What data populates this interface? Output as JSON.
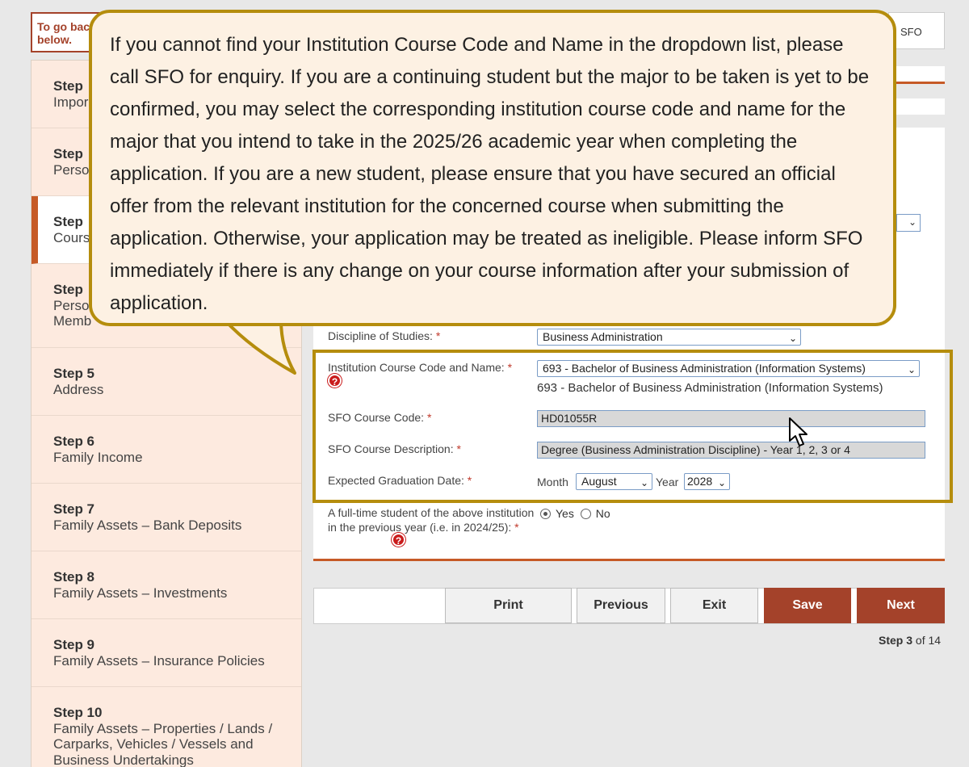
{
  "top": {
    "note": "To go back to ... below.",
    "note_visible_line1": "To go bac",
    "note_visible_line2": "below.",
    "right_label": "SFO"
  },
  "sidebar": {
    "steps": [
      {
        "num": "Step",
        "label": "Impor"
      },
      {
        "num": "Step",
        "label": "Perso"
      },
      {
        "num": "Step",
        "label": "Cours"
      },
      {
        "num": "Step",
        "label": "Perso",
        "label2": "Memb"
      },
      {
        "num": "Step 5",
        "label": "Address"
      },
      {
        "num": "Step 6",
        "label": "Family Income"
      },
      {
        "num": "Step 7",
        "label": "Family Assets – Bank Deposits"
      },
      {
        "num": "Step 8",
        "label": "Family Assets – Investments"
      },
      {
        "num": "Step 9",
        "label": "Family Assets – Insurance Policies"
      },
      {
        "num": "Step 10",
        "label": "Family Assets – Properties / Lands / Carparks, Vehicles / Vessels and Business Undertakings"
      }
    ]
  },
  "callout": {
    "text": "If you cannot find your Institution Course Code and Name in the dropdown list, please call SFO for enquiry.  If you are a continuing student but the major to be taken is yet to be confirmed, you may select the corresponding institution course code and name for the major that you intend to take in the 2025/26 academic year when completing the application. If you are a new student, please ensure that you have secured an official offer from the relevant institution for the concerned course when submitting the application. Otherwise, your application may be treated as ineligible. Please inform SFO immediately if there is any change on your course information after your submission of application."
  },
  "form": {
    "discipline_label": "Discipline of Studies:",
    "discipline_value": "Business Administration",
    "course_label": "Institution Course Code and Name:",
    "course_value": "693 - Bachelor of Business Administration (Information Systems)",
    "course_selected_text": "693 - Bachelor of Business Administration (Information Systems)",
    "sfo_code_label": "SFO Course Code:",
    "sfo_code_value": "HD01055R",
    "sfo_desc_label": "SFO Course Description:",
    "sfo_desc_value": "Degree (Business Administration Discipline) - Year 1, 2, 3 or 4",
    "grad_label": "Expected Graduation Date:",
    "month_label": "Month",
    "month_value": "August",
    "year_label": "Year",
    "year_value": "2028",
    "fulltime_label": "A full-time student of the above institution in the previous year (i.e. in 2024/25):",
    "yes_label": "Yes",
    "no_label": "No",
    "required_mark": "*",
    "help_glyph": "?"
  },
  "buttons": {
    "print": "Print",
    "previous": "Previous",
    "exit": "Exit",
    "save": "Save",
    "next": "Next"
  },
  "progress": {
    "step_word": "Step",
    "current": "3",
    "of_text": "of 14"
  }
}
